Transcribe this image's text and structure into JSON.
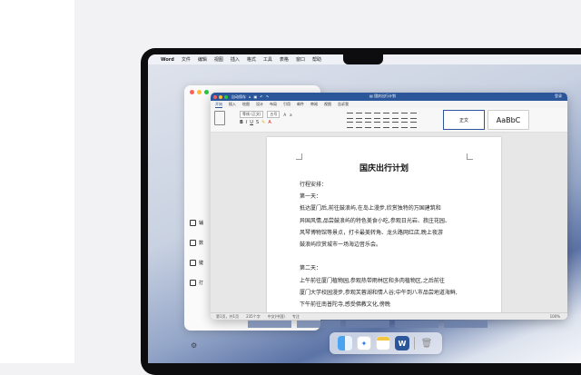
{
  "menubar": {
    "app_name": "Word",
    "items": [
      "文件",
      "编辑",
      "视图",
      "插入",
      "格式",
      "工具",
      "表格",
      "窗口",
      "帮助"
    ]
  },
  "settings_panel": {
    "items": [
      "辅",
      "数",
      "键",
      "打"
    ]
  },
  "word": {
    "title": "国庆出行计划",
    "autosave": "自动保存",
    "account": "登录",
    "tabs": [
      "开始",
      "插入",
      "绘图",
      "设计",
      "布局",
      "引用",
      "邮件",
      "审阅",
      "视图",
      "告诉我"
    ],
    "font_name": "等线 (正文)",
    "font_size": "五号",
    "style_preview": "AaBbC",
    "style_normal": "正文"
  },
  "document": {
    "heading": "国庆出行计划",
    "lines": [
      "行程安排：",
      "第一天：",
      "抵达厦门后,前往鼓浪屿,在岛上漫步,欣赏独特的万国建筑和",
      "异国风情,品尝鼓浪屿的特色美食小吃,参观日光岩、菽庄花园、",
      "风琴博物馆等景点，打卡最美转角、龙头路网红店,晚上夜游",
      "鼓浪屿欣赏城市一场海边音乐会。",
      "",
      "第二天：",
      "上午前往厦门植物园,参观热带雨林区和多肉植物区,之后前往",
      "厦门大学校园漫步,参观芙蓉湖和情人谷;中午到八市品尝地道海鲜,",
      "下午前往南普陀寺,感受佛教文化,傍晚"
    ]
  },
  "statusbar": {
    "page": "第1页，共1页",
    "words": "235个字",
    "lang": "中文(中国)",
    "focus": "专注",
    "zoom": "100%"
  },
  "dock": {
    "apps": [
      "Finder",
      "Safari",
      "Notes",
      "Word",
      "Trash"
    ]
  }
}
